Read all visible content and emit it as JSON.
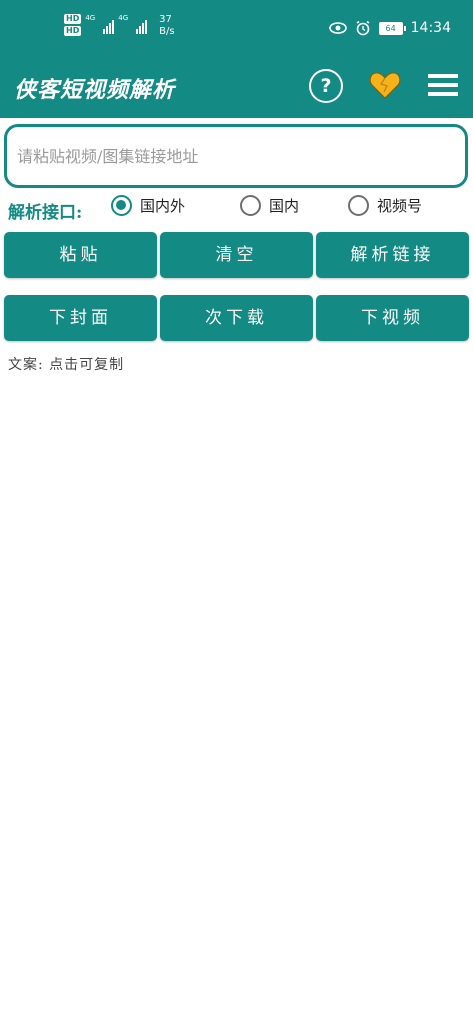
{
  "status_bar": {
    "sim1": "HD",
    "sim2": "HD",
    "net1": "4G",
    "net2": "4G",
    "speed_value": "37",
    "speed_unit": "B/s",
    "battery": "64",
    "time": "14:34"
  },
  "app_bar": {
    "title": "侠客短视频解析",
    "help_glyph": "?"
  },
  "url_input": {
    "placeholder": "请粘贴视频/图集链接地址",
    "value": ""
  },
  "interface": {
    "label": "解析接口:",
    "options": [
      {
        "label": "国内外",
        "selected": true
      },
      {
        "label": "国内",
        "selected": false
      },
      {
        "label": "视频号",
        "selected": false
      }
    ]
  },
  "buttons_row1": [
    "粘贴",
    "清空",
    "解析链接"
  ],
  "buttons_row2": [
    "下封面",
    "次下载",
    "下视频"
  ],
  "copy_hint": "文案: 点击可复制",
  "colors": {
    "primary": "#138a83",
    "heart": "#f6b21a",
    "background": "#ffffff"
  }
}
